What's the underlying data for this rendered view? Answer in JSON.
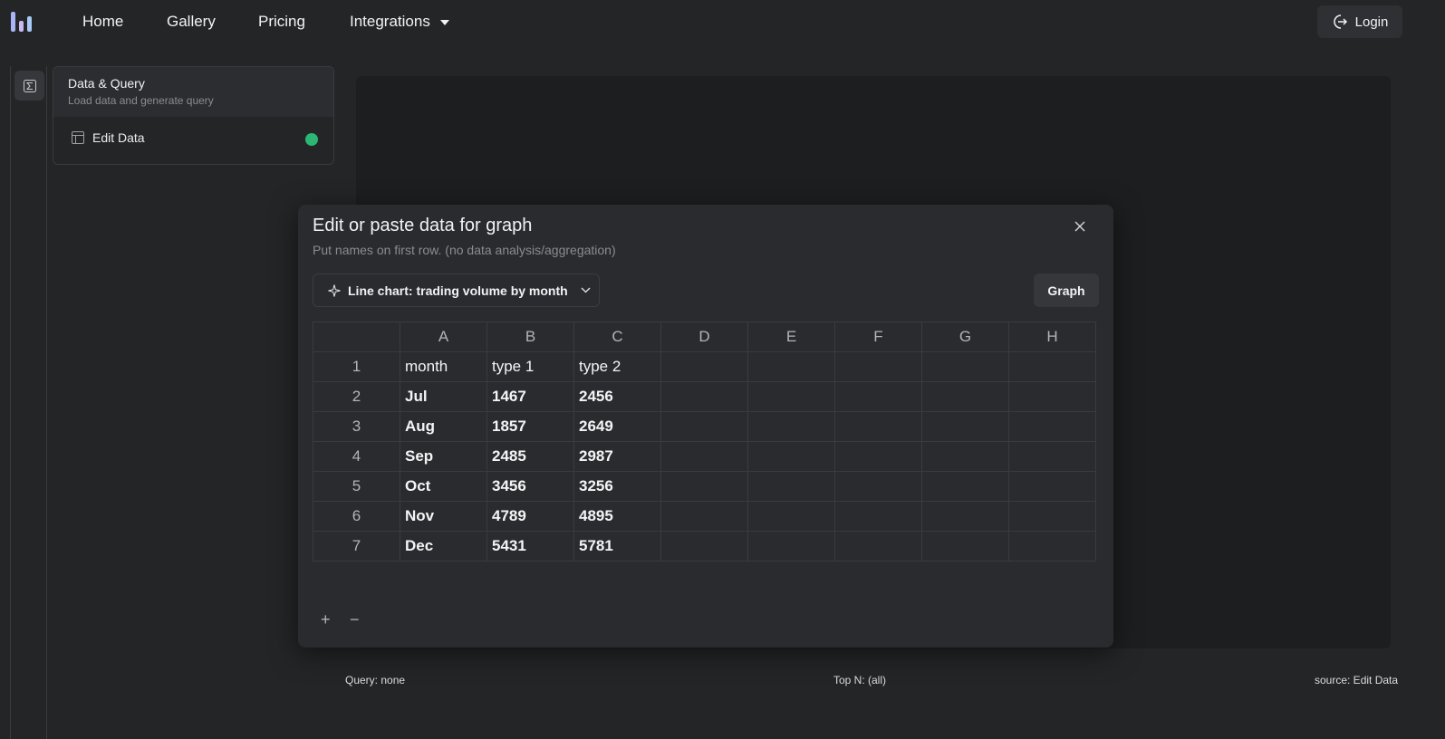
{
  "nav": {
    "links": [
      "Home",
      "Gallery",
      "Pricing",
      "Integrations"
    ],
    "login_label": "Login"
  },
  "sidebar": {
    "panel_title": "Data & Query",
    "panel_subtitle": "Load data and generate query",
    "item_label": "Edit Data",
    "status_color": "#2bb673"
  },
  "footer": {
    "query": "Query: none",
    "top_n": "Top N: (all)",
    "source": "source: Edit Data"
  },
  "modal": {
    "title": "Edit or paste data for graph",
    "subtitle": "Put names on first row. (no data analysis/aggregation)",
    "chart_select_label": "Line chart: trading volume by month",
    "graph_button": "Graph",
    "add_row": "+",
    "remove_row": "−"
  },
  "grid": {
    "columns": [
      "A",
      "B",
      "C",
      "D",
      "E",
      "F",
      "G",
      "H"
    ],
    "rows": [
      {
        "num": "1",
        "cells": [
          "month",
          "type 1",
          "type 2",
          "",
          "",
          "",
          "",
          ""
        ]
      },
      {
        "num": "2",
        "cells": [
          "Jul",
          "1467",
          "2456",
          "",
          "",
          "",
          "",
          ""
        ]
      },
      {
        "num": "3",
        "cells": [
          "Aug",
          "1857",
          "2649",
          "",
          "",
          "",
          "",
          ""
        ]
      },
      {
        "num": "4",
        "cells": [
          "Sep",
          "2485",
          "2987",
          "",
          "",
          "",
          "",
          ""
        ]
      },
      {
        "num": "5",
        "cells": [
          "Oct",
          "3456",
          "3256",
          "",
          "",
          "",
          "",
          ""
        ]
      },
      {
        "num": "6",
        "cells": [
          "Nov",
          "4789",
          "4895",
          "",
          "",
          "",
          "",
          ""
        ]
      },
      {
        "num": "7",
        "cells": [
          "Dec",
          "5431",
          "5781",
          "",
          "",
          "",
          "",
          ""
        ]
      }
    ]
  },
  "colors": {
    "accent_logo": "#a8b4f5",
    "background": "#242527",
    "modal": "#2a2b2e"
  }
}
